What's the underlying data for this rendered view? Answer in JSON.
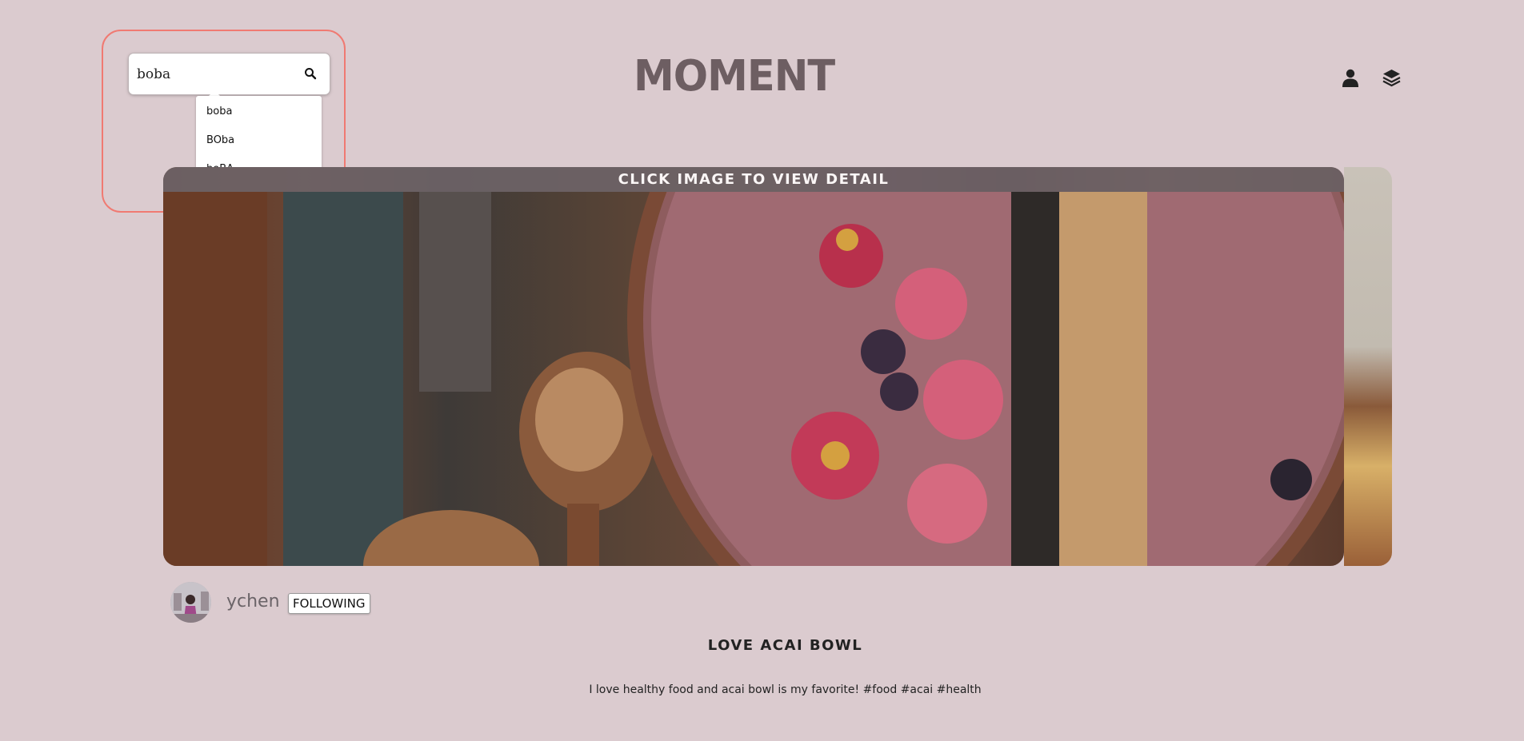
{
  "search": {
    "value": "boba",
    "suggestions": [
      "boba",
      "BOba",
      "boBA"
    ]
  },
  "header": {
    "logo": "MOMENT",
    "icons": [
      "user-icon",
      "layers-icon"
    ]
  },
  "carousel": {
    "banner": "CLICK IMAGE TO VIEW DETAIL"
  },
  "post": {
    "author": "ychen",
    "follow_label": "FOLLOWING",
    "title": "LOVE ACAI BOWL",
    "description": "I love healthy food and acai bowl is my favorite! #food #acai #health"
  },
  "colors": {
    "background": "#dbcbcf",
    "logo": "#6d5e62",
    "highlight": "#f07a72"
  }
}
